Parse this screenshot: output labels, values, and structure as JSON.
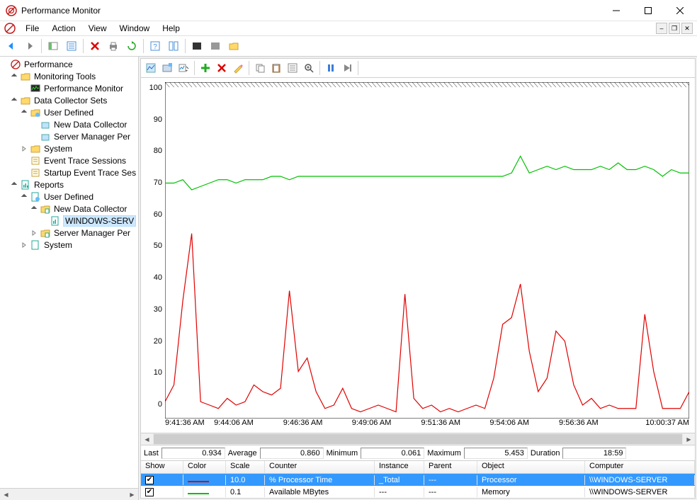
{
  "window": {
    "title": "Performance Monitor"
  },
  "menus": {
    "file": "File",
    "action": "Action",
    "view": "View",
    "window": "Window",
    "help": "Help"
  },
  "tree": {
    "root": "Performance",
    "monitoring": "Monitoring Tools",
    "perfmon": "Performance Monitor",
    "dcs": "Data Collector Sets",
    "user_defined": "User Defined",
    "ndc": "New Data Collector",
    "smp": "Server Manager Per",
    "system": "System",
    "ets": "Event Trace Sessions",
    "sets": "Startup Event Trace Ses",
    "reports": "Reports",
    "r_user_defined": "User Defined",
    "r_ndc": "New Data Collector",
    "r_windows": "WINDOWS-SERV",
    "r_smp": "Server Manager Per",
    "r_system": "System"
  },
  "chart_data": {
    "type": "line",
    "ylim": [
      0,
      100
    ],
    "y_ticks": [
      "100",
      "90",
      "80",
      "70",
      "60",
      "50",
      "40",
      "30",
      "20",
      "10",
      "0"
    ],
    "x_ticks": [
      {
        "pos": 0.0,
        "label": "9:41:36 AM"
      },
      {
        "pos": 0.131,
        "label": "9:44:06 AM"
      },
      {
        "pos": 0.263,
        "label": "9:46:36 AM"
      },
      {
        "pos": 0.394,
        "label": "9:49:06 AM"
      },
      {
        "pos": 0.526,
        "label": "9:51:36 AM"
      },
      {
        "pos": 0.657,
        "label": "9:54:06 AM"
      },
      {
        "pos": 0.789,
        "label": "9:56:36 AM"
      },
      {
        "pos": 1.0,
        "label": "10:00:37 AM"
      }
    ],
    "series": [
      {
        "name": "Available MBytes (scaled ×0.1)",
        "color": "#00c000",
        "values": [
          70,
          70,
          71,
          68,
          69,
          70,
          71,
          71,
          70,
          71,
          71,
          71,
          72,
          72,
          71,
          72,
          72,
          72,
          72,
          72,
          72,
          72,
          72,
          72,
          72,
          72,
          72,
          72,
          72,
          72,
          72,
          72,
          72,
          72,
          72,
          72,
          72,
          72,
          72,
          73,
          78,
          73,
          74,
          75,
          74,
          75,
          74,
          74,
          74,
          75,
          74,
          76,
          74,
          74,
          75,
          74,
          72,
          74,
          73,
          73
        ]
      },
      {
        "name": "% Processor Time (scaled ×10)",
        "color": "#e00000",
        "values": [
          5,
          10,
          35,
          55,
          5,
          4,
          3,
          6,
          4,
          5,
          10,
          8,
          7,
          9,
          38,
          14,
          18,
          8,
          3,
          4,
          9,
          3,
          2,
          3,
          4,
          3,
          2,
          37,
          6,
          3,
          4,
          2,
          3,
          2,
          3,
          4,
          3,
          12,
          28,
          30,
          40,
          20,
          8,
          12,
          26,
          23,
          10,
          4,
          6,
          3,
          4,
          3,
          3,
          3,
          31,
          14,
          3,
          3,
          3,
          8
        ]
      }
    ]
  },
  "stats": {
    "last_label": "Last",
    "last": "0.934",
    "avg_label": "Average",
    "avg": "0.860",
    "min_label": "Minimum",
    "min": "0.061",
    "max_label": "Maximum",
    "max": "5.453",
    "dur_label": "Duration",
    "dur": "18:59"
  },
  "table": {
    "headers": {
      "show": "Show",
      "color": "Color",
      "scale": "Scale",
      "counter": "Counter",
      "instance": "Instance",
      "parent": "Parent",
      "object": "Object",
      "computer": "Computer"
    },
    "rows": [
      {
        "checked": true,
        "color": "#e00000",
        "scale": "10.0",
        "counter": "% Processor Time",
        "instance": "_Total",
        "parent": "---",
        "object": "Processor",
        "computer": "\\\\WINDOWS-SERVER",
        "selected": true
      },
      {
        "checked": true,
        "color": "#00c000",
        "scale": "0.1",
        "counter": "Available MBytes",
        "instance": "---",
        "parent": "---",
        "object": "Memory",
        "computer": "\\\\WINDOWS-SERVER",
        "selected": false
      }
    ]
  }
}
